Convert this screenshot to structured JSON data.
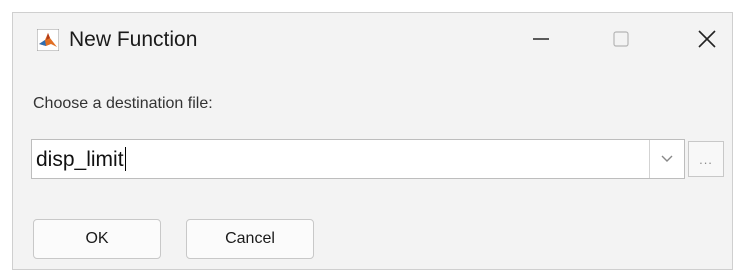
{
  "window": {
    "title": "New Function",
    "app_icon": "matlab-logo-icon",
    "controls": {
      "minimize_icon": "minimize-icon",
      "maximize_icon": "maximize-icon",
      "close_icon": "close-icon"
    }
  },
  "form": {
    "prompt": "Choose a destination file:",
    "destination_value": "disp_limit",
    "dropdown_icon": "chevron-down-icon",
    "browse_label": "..."
  },
  "buttons": {
    "ok_label": "OK",
    "cancel_label": "Cancel"
  },
  "colors": {
    "window_background": "#f3f3f3",
    "logo_orange": "#e16f24",
    "logo_blue": "#2c6fb5"
  }
}
